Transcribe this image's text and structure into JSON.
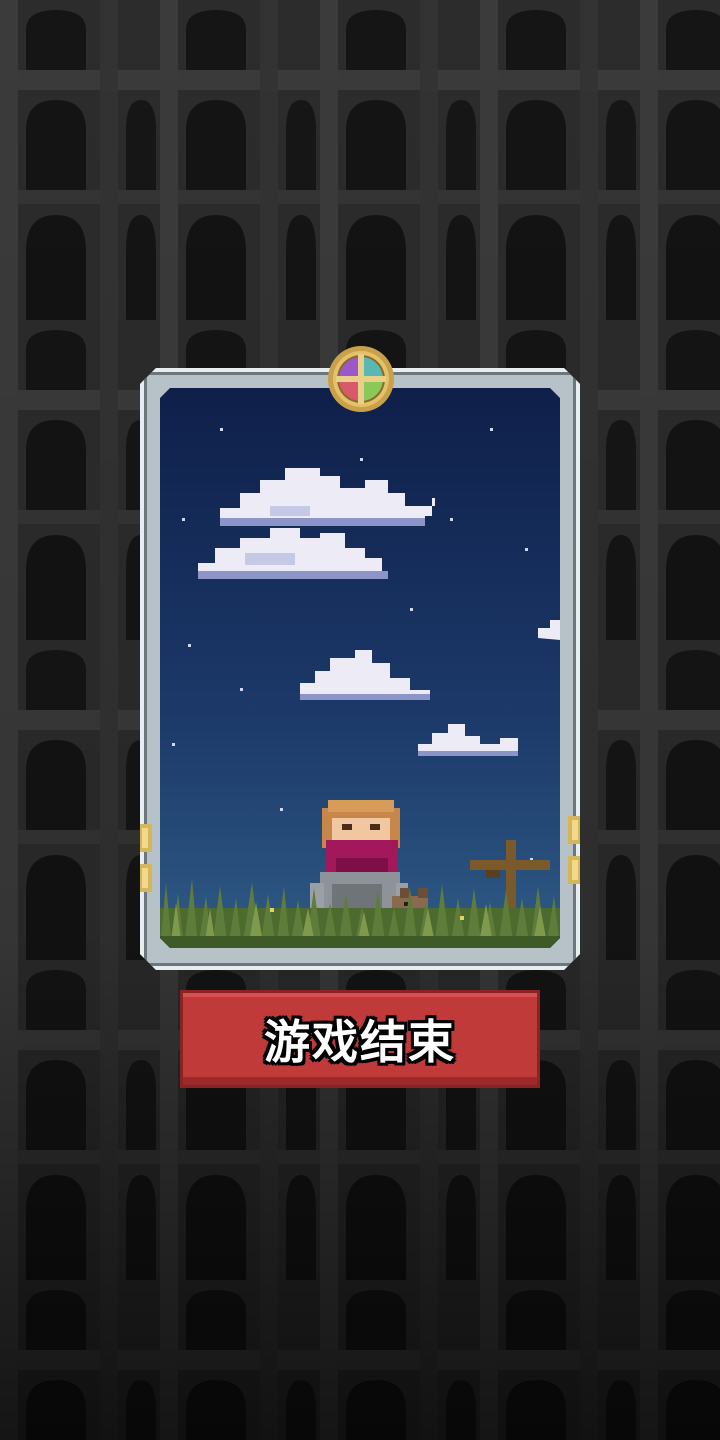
{
  "screen": {
    "name": "game-over-screen"
  },
  "card": {
    "scene": "night-sky-with-clouds-hero-and-dog-in-grass",
    "medal_icon": "compass-medal-icon",
    "colors": {
      "sky_top": "#0f1f4a",
      "sky_bottom": "#2f5b86",
      "frame": "#e8edf0",
      "grass": "#5f7d3a"
    }
  },
  "action_button": {
    "label": "游戏结束",
    "color": "#c03a3a"
  }
}
